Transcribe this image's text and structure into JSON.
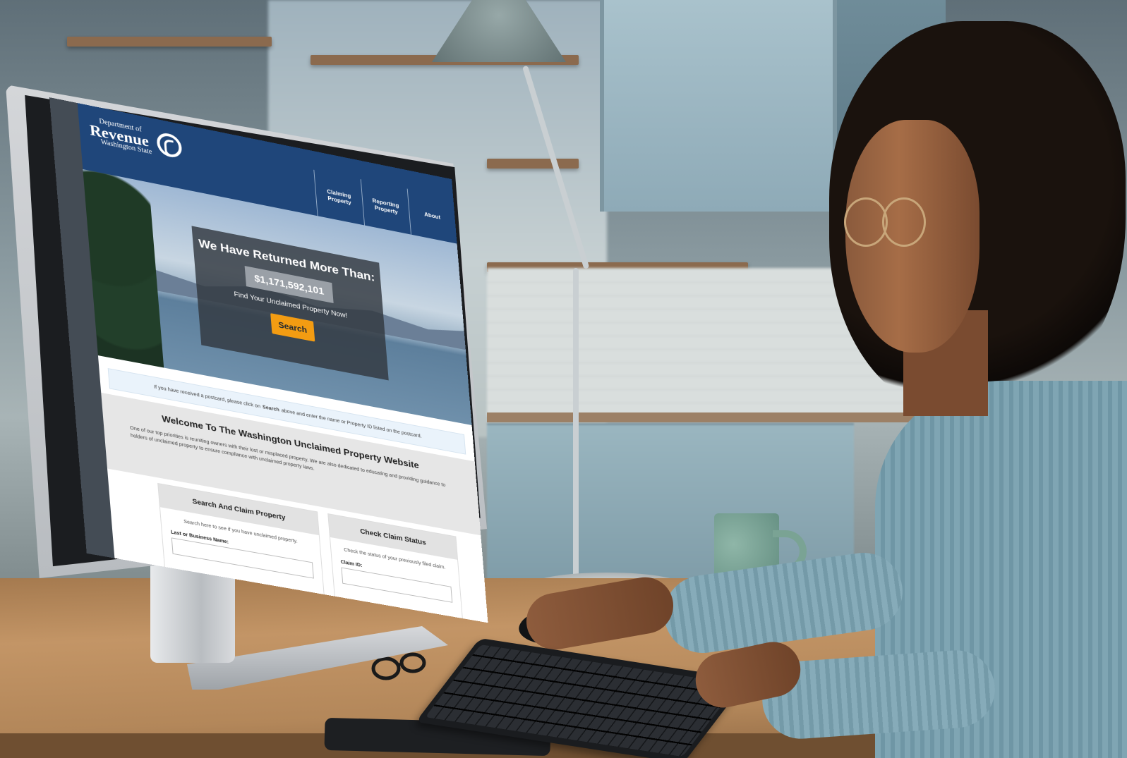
{
  "site": {
    "logo": {
      "line1": "Department of",
      "line2": "Revenue",
      "line3": "Washington State"
    },
    "nav": [
      {
        "label": "Claiming Property"
      },
      {
        "label": "Reporting Property"
      },
      {
        "label": "About"
      }
    ],
    "hero": {
      "title": "We Have Returned More Than:",
      "amount": "$1,171,592,101",
      "subtitle": "Find Your Unclaimed Property Now!",
      "search_button": "Search"
    },
    "notice": {
      "prefix": "If you have received a postcard, please click on",
      "bold": "Search",
      "suffix": "above and enter the name or Property ID listed on the postcard."
    },
    "welcome": {
      "title": "Welcome To The Washington Unclaimed Property Website",
      "body": "One of our top priorities is reuniting owners with their lost or misplaced property. We are also dedicated to educating and providing guidance to holders of unclaimed property to ensure compliance with unclaimed property laws."
    },
    "cards": {
      "search_claim": {
        "title": "Search And Claim Property",
        "text": "Search here to see if you have unclaimed property.",
        "field_label": "Last or Business Name:"
      },
      "claim_status": {
        "title": "Check Claim Status",
        "text": "Check the status of your previously filed claim.",
        "field_label": "Claim ID:"
      }
    }
  },
  "colors": {
    "header_blue": "#1f467a",
    "search_orange": "#f39c12",
    "notice_bg": "#eaf3fb"
  }
}
